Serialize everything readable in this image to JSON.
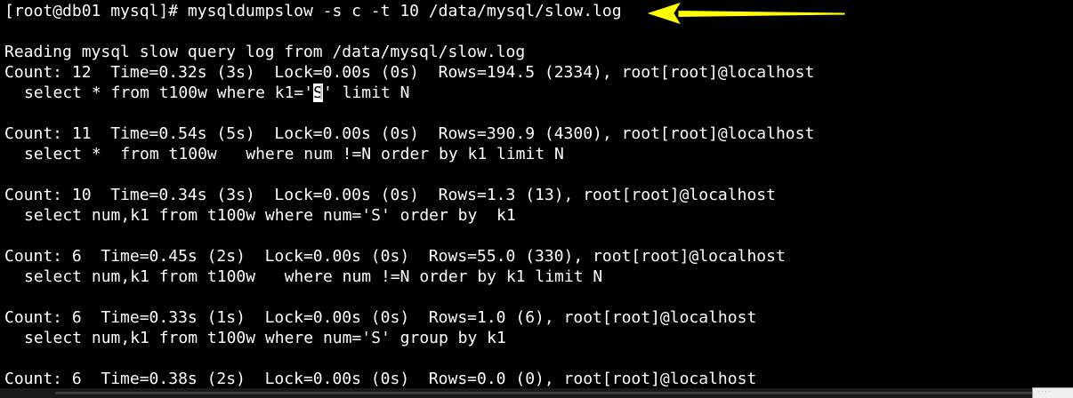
{
  "terminal": {
    "prompt": "[root@db01 mysql]# ",
    "command": "mysqldumpslow -s c -t 10 /data/mysql/slow.log",
    "reading_line": "Reading mysql slow query log from /data/mysql/slow.log",
    "entries": [
      {
        "stats": "Count: 12  Time=0.32s (3s)  Lock=0.00s (0s)  Rows=194.5 (2334), root[root]@localhost",
        "query_before_cursor": "select * from t100w where k1='",
        "cursor_char": "S",
        "query_after_cursor": "' limit N"
      },
      {
        "stats": "Count: 11  Time=0.54s (5s)  Lock=0.00s (0s)  Rows=390.9 (4300), root[root]@localhost",
        "query": "select *  from t100w   where num !=N order by k1 limit N"
      },
      {
        "stats": "Count: 10  Time=0.34s (3s)  Lock=0.00s (0s)  Rows=1.3 (13), root[root]@localhost",
        "query": "select num,k1 from t100w where num='S' order by  k1"
      },
      {
        "stats": "Count: 6  Time=0.45s (2s)  Lock=0.00s (0s)  Rows=55.0 (330), root[root]@localhost",
        "query": "select num,k1 from t100w   where num !=N order by k1 limit N"
      },
      {
        "stats": "Count: 6  Time=0.33s (1s)  Lock=0.00s (0s)  Rows=1.0 (6), root[root]@localhost",
        "query": "select num,k1 from t100w where num='S' group by k1"
      },
      {
        "stats": "Count: 6  Time=0.38s (2s)  Lock=0.00s (0s)  Rows=0.0 (0), root[root]@localhost"
      }
    ]
  },
  "annotation": {
    "icon": "arrow-left-icon",
    "color": "#ffff00"
  },
  "colors": {
    "background": "#000000",
    "foreground": "#ffffff"
  }
}
